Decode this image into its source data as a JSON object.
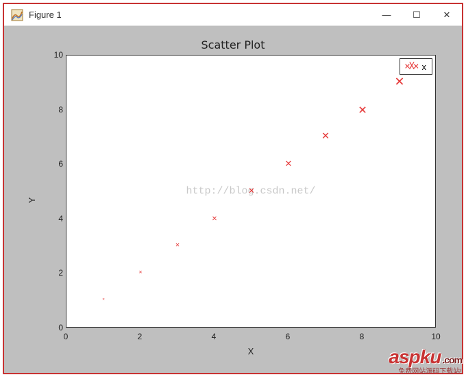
{
  "window": {
    "title": "Figure 1",
    "minimize_glyph": "—",
    "maximize_glyph": "☐",
    "close_glyph": "✕"
  },
  "chart_data": {
    "type": "scatter",
    "title": "Scatter Plot",
    "xlabel": "X",
    "ylabel": "Y",
    "xlim": [
      0,
      10
    ],
    "ylim": [
      0,
      10
    ],
    "xticks": [
      0,
      2,
      4,
      6,
      8,
      10
    ],
    "yticks": [
      0,
      2,
      4,
      6,
      8,
      10
    ],
    "series": [
      {
        "name": "x",
        "marker": "x",
        "color": "#e63b3b",
        "x": [
          1,
          2,
          3,
          4,
          5,
          6,
          7,
          8,
          9
        ],
        "y": [
          1,
          2,
          3,
          4,
          5,
          6,
          7,
          8,
          9
        ],
        "size": [
          6,
          8,
          10,
          12,
          14,
          16,
          18,
          20,
          22
        ]
      }
    ],
    "legend": {
      "position": "upper-right",
      "entries": [
        "x"
      ]
    }
  },
  "watermarks": {
    "center": "http://blog.csdn.net/",
    "logo": "aspku",
    "logo_suffix": ".com",
    "sub": "免费网站源码下载站!"
  }
}
